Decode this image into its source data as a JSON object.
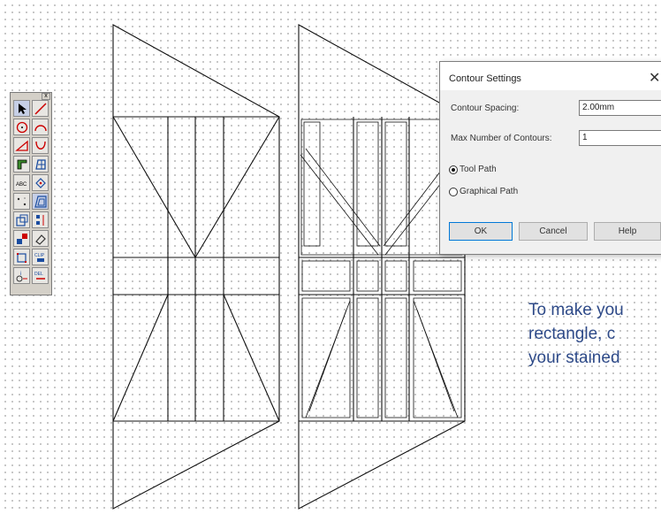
{
  "dialog": {
    "title": "Contour Settings",
    "close_glyph": "✕",
    "spacing_label": "Contour Spacing:",
    "spacing_value": "2.00mm",
    "max_label": "Max Number of Contours:",
    "max_value": "1",
    "radio_tool_path": "Tool Path",
    "radio_graphical_path": "Graphical Path",
    "selected_option": "Tool Path",
    "ok_label": "OK",
    "cancel_label": "Cancel",
    "help_label": "Help"
  },
  "palette": {
    "close_glyph": "x",
    "tools": [
      "select-arrow-icon",
      "line-icon",
      "circle-icon",
      "arc-icon",
      "triangle-icon",
      "curve-icon",
      "offset-icon",
      "fill-pattern-icon",
      "text-icon",
      "rotate-icon",
      "node-icon",
      "contour-icon",
      "group-icon",
      "align-icon",
      "color-icon",
      "eraser-icon",
      "transform-icon",
      "clip-icon",
      "info-icon",
      "delete-icon"
    ],
    "labels": {
      "text": "ABC",
      "clip": "CLIP",
      "info": "i",
      "delete": "DEL"
    }
  },
  "note": {
    "lines": [
      "To make you",
      "rectangle, c",
      "your stained"
    ]
  },
  "colors": {
    "text_accent": "#2e4a88",
    "dialog_bg": "#f0f0f0",
    "dot_grid": "#b9b9b9"
  }
}
